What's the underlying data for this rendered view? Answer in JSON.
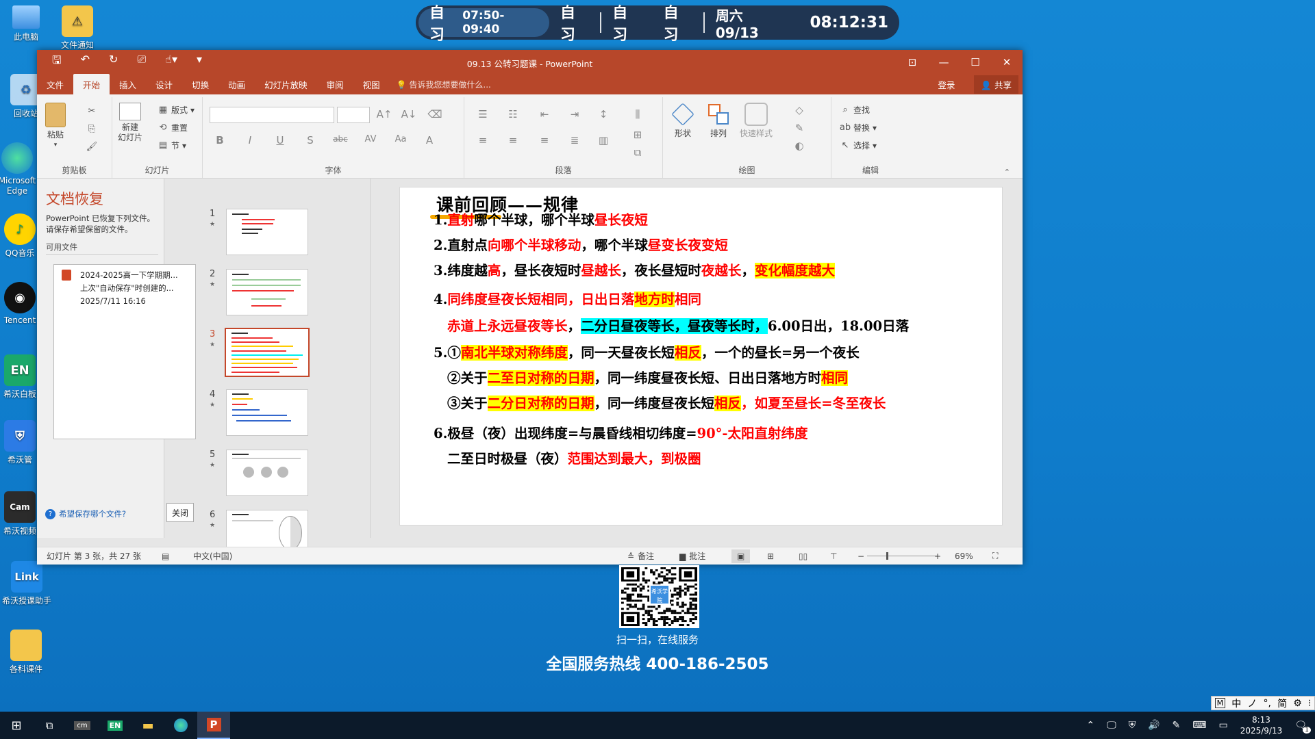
{
  "desktop": {
    "icons": [
      {
        "label": "此电脑",
        "icon": "computer-icon"
      },
      {
        "label": "文件通知",
        "icon": "folder-warning-icon"
      },
      {
        "label": "回收站",
        "icon": "recycle-bin-icon"
      },
      {
        "label": "Microsoft Edge",
        "icon": "edge-icon"
      },
      {
        "label": "QQ音乐",
        "icon": "qq-music-icon"
      },
      {
        "label": "Tencent",
        "icon": "qq-penguin-icon"
      },
      {
        "label": "希沃白板",
        "icon": "en-board-icon"
      },
      {
        "label": "希沃管",
        "icon": "shield-icon"
      },
      {
        "label": "希沃视频",
        "icon": "camera-icon"
      },
      {
        "label": "希沃授课助手",
        "icon": "link-icon"
      },
      {
        "label": "各科课件",
        "icon": "courseware-folder-icon"
      }
    ]
  },
  "schedule": {
    "current_label": "自习",
    "current_time": "07:50-09:40",
    "next1": "自习",
    "next2": "自习",
    "next3": "自习",
    "date": "周六 09/13",
    "clock": "08:12:31"
  },
  "window": {
    "title": "09.13 公转习题课 - PowerPoint",
    "menu": [
      "文件",
      "开始",
      "插入",
      "设计",
      "切换",
      "动画",
      "幻灯片放映",
      "审阅",
      "视图"
    ],
    "tell_me": "告诉我您想要做什么...",
    "login": "登录",
    "share": "共享"
  },
  "ribbon": {
    "groups": {
      "clipboard": "剪贴板",
      "slides": "幻灯片",
      "font": "字体",
      "paragraph": "段落",
      "drawing": "绘图",
      "editing": "编辑"
    },
    "paste": "粘贴",
    "new_slide": "新建\n幻灯片",
    "new_slide_l1": "新建",
    "new_slide_l2": "幻灯片",
    "layout": "版式",
    "reset": "重置",
    "section": "节",
    "shapes": "形状",
    "arrange": "排列",
    "quick_styles": "快速样式",
    "find": "查找",
    "replace": "替换",
    "select": "选择"
  },
  "recovery": {
    "title": "文档恢复",
    "desc": "PowerPoint 已恢复下列文件。请保存希望保留的文件。",
    "available": "可用文件",
    "file_name": "2024-2025高一下学期期...",
    "file_note": "上次\"自动保存\"时创建的...",
    "file_date": "2025/7/11 16:16",
    "help": "希望保存哪个文件?",
    "close": "关闭"
  },
  "thumbnails": [
    "1",
    "2",
    "3",
    "4",
    "5",
    "6"
  ],
  "slide": {
    "title": "课前回顾——规律",
    "lines": [
      {
        "segs": [
          {
            "t": "1.",
            "s": ""
          },
          {
            "t": "直射",
            "s": "r"
          },
          {
            "t": "哪个半球，哪个半球",
            "s": ""
          },
          {
            "t": "昼长夜短",
            "s": "r"
          }
        ]
      },
      {
        "segs": [
          {
            "t": "2.直射点",
            "s": ""
          },
          {
            "t": "向哪个半球移动",
            "s": "r"
          },
          {
            "t": "，哪个半球",
            "s": ""
          },
          {
            "t": "昼变长夜变短",
            "s": "r"
          }
        ]
      },
      {
        "segs": [
          {
            "t": "3.纬度越",
            "s": ""
          },
          {
            "t": "高",
            "s": "r"
          },
          {
            "t": "，昼长夜短时",
            "s": ""
          },
          {
            "t": "昼越长",
            "s": "r"
          },
          {
            "t": "，夜长昼短时",
            "s": ""
          },
          {
            "t": "夜越长",
            "s": "r"
          },
          {
            "t": "，",
            "s": ""
          },
          {
            "t": "变化幅度越大",
            "s": "y"
          }
        ]
      },
      {
        "segs": [
          {
            "t": "4.",
            "s": ""
          },
          {
            "t": "同纬度昼夜长短相同，日出日落",
            "s": "r"
          },
          {
            "t": "地方时",
            "s": "y"
          },
          {
            "t": "相同",
            "s": "r"
          }
        ]
      },
      {
        "segs": [
          {
            "t": "赤道上永远昼夜等长",
            "s": "r"
          },
          {
            "t": "，",
            "s": ""
          },
          {
            "t": "二分日昼夜等长，昼夜等长时，",
            "s": "c"
          },
          {
            "t": "6.00日出，18.00日落",
            "s": ""
          }
        ]
      },
      {
        "segs": [
          {
            "t": "5.①",
            "s": ""
          },
          {
            "t": "南北半球对称纬度",
            "s": "y"
          },
          {
            "t": "，同一天昼夜长短",
            "s": ""
          },
          {
            "t": "相反",
            "s": "y"
          },
          {
            "t": "，一个的昼长=另一个夜长",
            "s": ""
          }
        ]
      },
      {
        "segs": [
          {
            "t": "②关于",
            "s": ""
          },
          {
            "t": "二至日对称的日期",
            "s": "y"
          },
          {
            "t": "，同一纬度昼夜长短、日出日落地方时",
            "s": ""
          },
          {
            "t": "相同",
            "s": "y"
          }
        ]
      },
      {
        "segs": [
          {
            "t": "③关于",
            "s": ""
          },
          {
            "t": "二分日对称的日期",
            "s": "y"
          },
          {
            "t": "，同一纬度昼夜长短",
            "s": ""
          },
          {
            "t": "相反",
            "s": "y"
          },
          {
            "t": "，如夏至昼长=冬至夜长",
            "s": "r"
          }
        ]
      },
      {
        "segs": [
          {
            "t": "6.极昼（夜）出现纬度=与晨昏线相切纬度=",
            "s": ""
          },
          {
            "t": "90°-太阳直射纬度",
            "s": "r"
          }
        ]
      },
      {
        "segs": [
          {
            "t": "二至日时极昼（夜）",
            "s": ""
          },
          {
            "t": "范围达到最大，到极圈",
            "s": "r"
          }
        ]
      }
    ]
  },
  "status": {
    "slide_info": "幻灯片 第 3 张，共 27 张",
    "language": "中文(中国)",
    "notes": "备注",
    "comments": "批注",
    "zoom": "69%"
  },
  "service": {
    "qr_badge": "希沃学院",
    "scan": "扫一扫，在线服务",
    "hotline": "全国服务热线 400-186-2505"
  },
  "ime": [
    "M",
    "中",
    "ノ",
    "°,",
    "简",
    "⚙",
    "⁝"
  ],
  "taskbar": {
    "time": "8:13",
    "date": "2025/9/13",
    "notif": "1"
  },
  "colors": {
    "ppt_accent": "#b7472a",
    "highlight_yellow": "#ffff00",
    "highlight_cyan": "#00ffff",
    "text_red": "#ff0000"
  }
}
